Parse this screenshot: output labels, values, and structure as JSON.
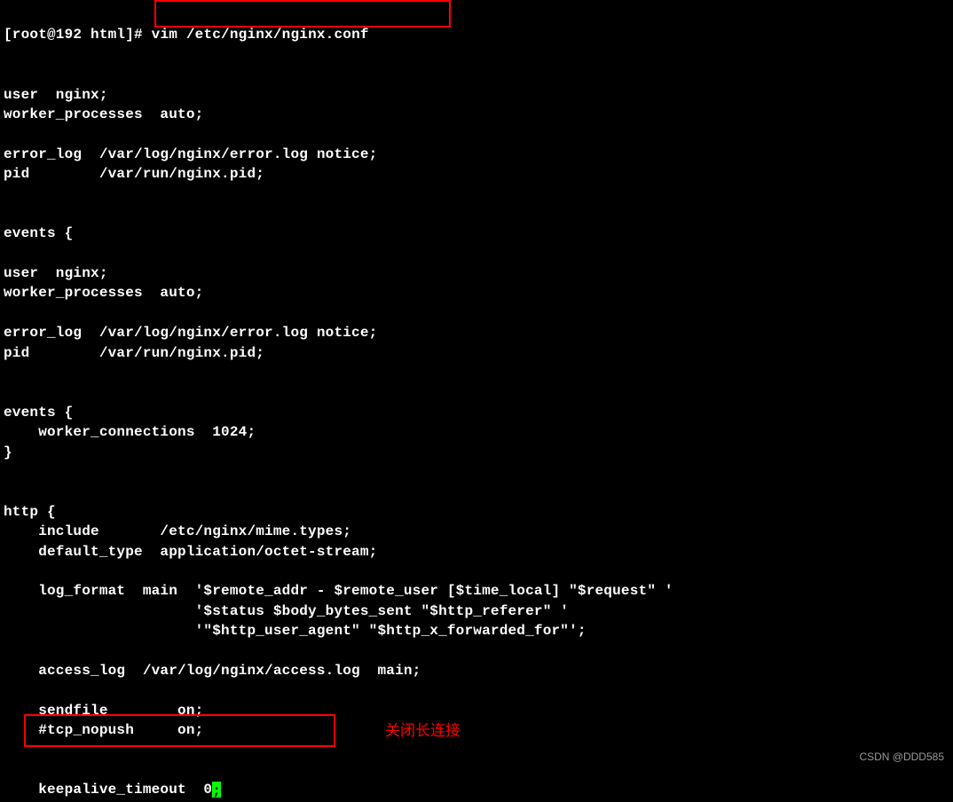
{
  "terminal": {
    "prompt": "[root@192 html]# ",
    "command": "vim /etc/nginx/nginx.conf",
    "lines": [
      "",
      "",
      "user  nginx;",
      "worker_processes  auto;",
      "",
      "error_log  /var/log/nginx/error.log notice;",
      "pid        /var/run/nginx.pid;",
      "",
      "",
      "events {",
      "",
      "user  nginx;",
      "worker_processes  auto;",
      "",
      "error_log  /var/log/nginx/error.log notice;",
      "pid        /var/run/nginx.pid;",
      "",
      "",
      "events {",
      "    worker_connections  1024;",
      "}",
      "",
      "",
      "http {",
      "    include       /etc/nginx/mime.types;",
      "    default_type  application/octet-stream;",
      "",
      "    log_format  main  '$remote_addr - $remote_user [$time_local] \"$request\" '",
      "                      '$status $body_bytes_sent \"$http_referer\" '",
      "                      '\"$http_user_agent\" \"$http_x_forwarded_for\"';",
      "",
      "    access_log  /var/log/nginx/access.log  main;",
      "",
      "    sendfile        on;",
      "    #tcp_nopush     on;",
      ""
    ],
    "highlight_line_prefix": "    keepalive_timeout  0",
    "highlight_line_suffix": ";",
    "cursor_char": ";"
  },
  "annotation": {
    "text": "关闭长连接"
  },
  "watermark": "CSDN @DDD585"
}
